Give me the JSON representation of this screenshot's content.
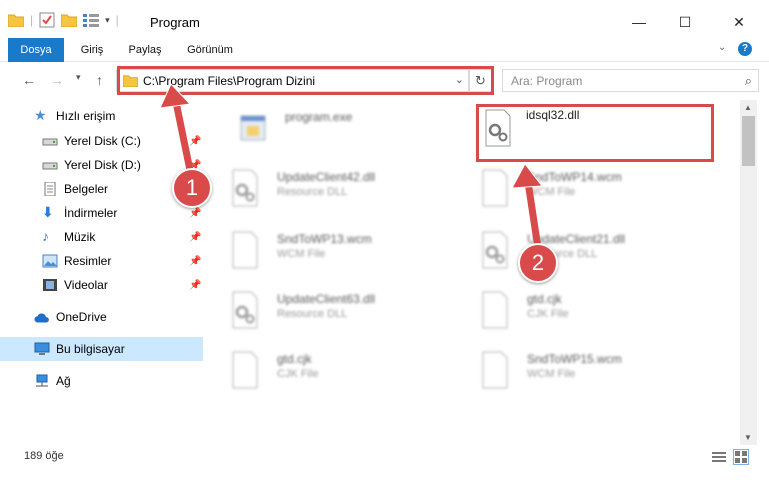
{
  "window": {
    "title": "Program",
    "minimize": "—",
    "maximize": "☐",
    "close": "✕"
  },
  "ribbon": {
    "tabs": [
      {
        "label": "Dosya",
        "active": true
      },
      {
        "label": "Giriş",
        "active": false
      },
      {
        "label": "Paylaş",
        "active": false
      },
      {
        "label": "Görünüm",
        "active": false
      }
    ]
  },
  "address": {
    "path": "C:\\Program Files\\Program Dizini",
    "search_placeholder": "Ara: Program"
  },
  "sidebar": {
    "items": [
      {
        "label": "Hızlı erişim",
        "icon": "star-icon",
        "pinned": false
      },
      {
        "label": "Yerel Disk (C:)",
        "icon": "drive-icon",
        "pinned": true
      },
      {
        "label": "Yerel Disk (D:)",
        "icon": "drive-icon",
        "pinned": true
      },
      {
        "label": "Belgeler",
        "icon": "documents-icon",
        "pinned": true
      },
      {
        "label": "İndirmeler",
        "icon": "download-icon",
        "pinned": true
      },
      {
        "label": "Müzik",
        "icon": "music-icon",
        "pinned": true
      },
      {
        "label": "Resimler",
        "icon": "pictures-icon",
        "pinned": true
      },
      {
        "label": "Videolar",
        "icon": "video-icon",
        "pinned": true
      },
      {
        "label": "OneDrive",
        "icon": "cloud-icon",
        "pinned": false
      },
      {
        "label": "Bu bilgisayar",
        "icon": "computer-icon",
        "pinned": false,
        "selected": true
      },
      {
        "label": "Ağ",
        "icon": "network-icon",
        "pinned": false
      }
    ]
  },
  "files": [
    {
      "name": "program.exe",
      "type": "",
      "icon": "exe-icon",
      "highlighted": false
    },
    {
      "name": "idsql32.dll",
      "type": "",
      "icon": "dll-gear-icon",
      "highlighted": true
    },
    {
      "name": "UpdateClient42.dll",
      "type": "Resource DLL",
      "icon": "dll-gear-icon",
      "highlighted": false
    },
    {
      "name": "SndToWP14.wcm",
      "type": "WCM File",
      "icon": "file-icon",
      "highlighted": false
    },
    {
      "name": "SndToWP13.wcm",
      "type": "WCM File",
      "icon": "file-icon",
      "highlighted": false
    },
    {
      "name": "UpdateClient21.dll",
      "type": "Resource DLL",
      "icon": "dll-gear-icon",
      "highlighted": false
    },
    {
      "name": "UpdateClient63.dll",
      "type": "Resource DLL",
      "icon": "dll-gear-icon",
      "highlighted": false
    },
    {
      "name": "gtd.cjk",
      "type": "CJK File",
      "icon": "file-icon",
      "highlighted": false
    },
    {
      "name": "gtd.cjk",
      "type": "CJK File",
      "icon": "file-icon",
      "highlighted": false
    },
    {
      "name": "SndToWP15.wcm",
      "type": "WCM File",
      "icon": "file-icon",
      "highlighted": false
    }
  ],
  "status": {
    "item_count": "189 öğe"
  },
  "annotations": {
    "callout_1": "1",
    "callout_2": "2",
    "color": "#d94a4a"
  },
  "colors": {
    "accent": "#1979ca",
    "selection": "#cce8ff",
    "annotation": "#d94a4a"
  }
}
